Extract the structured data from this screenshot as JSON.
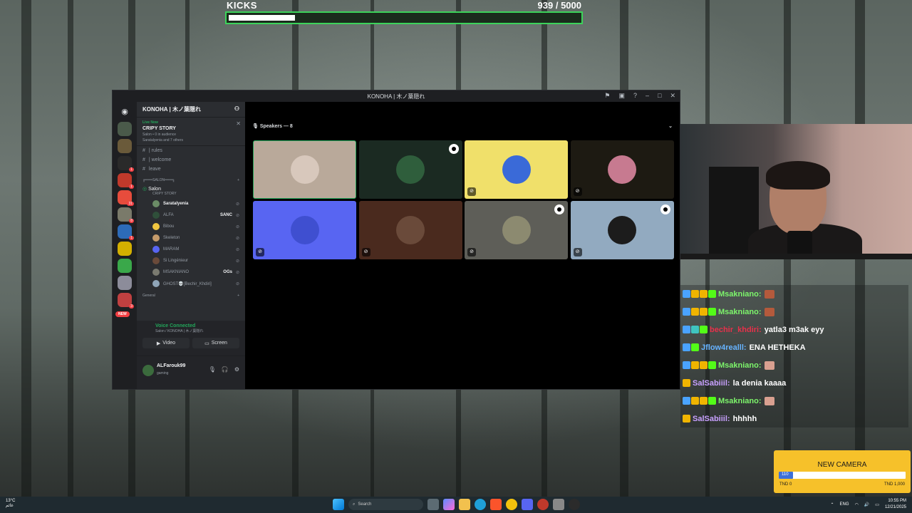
{
  "kicks": {
    "label": "KICKS",
    "count": "939",
    "goal": "/ 5000",
    "progress_fraction": 0.188
  },
  "discord": {
    "title": "KONOHA | 木ノ葉隠れ",
    "guild_name": "KONOHA | 木ノ葉隠れ",
    "event": {
      "live_label": "Live Now",
      "title": "CRIPY STORY",
      "meta": "Salon • 0 in audience",
      "participants": "Saratalyenia and 7 others"
    },
    "channels": {
      "rules_label": "| rules",
      "welcome_label": "| welcome",
      "leave_label": "leave",
      "category_salon": "╔═══SALON═══╗",
      "active_channel": "Salon",
      "active_channel_sub": "CRIPY STORY",
      "category_general": "General"
    },
    "voice_users": [
      {
        "name": "Saratalyenia",
        "tag": "",
        "color": "#6b8c66"
      },
      {
        "name": "ALFA",
        "tag": "SANC",
        "color": "#2f4f3a"
      },
      {
        "name": "Bibou",
        "tag": "",
        "color": "#f0c640"
      },
      {
        "name": "Skeleton",
        "tag": "",
        "color": "#c59b6b"
      },
      {
        "name": "MARAM",
        "tag": "",
        "color": "#5865f2"
      },
      {
        "name": "Si Lingénieur",
        "tag": "",
        "color": "#6a4a3a"
      },
      {
        "name": "MSAKNIANO",
        "tag": "OGs",
        "color": "#7a7a70"
      },
      {
        "name": "GHOST💀[Bechir_Khdiri]",
        "tag": "",
        "color": "#8fa5b8"
      }
    ],
    "voice_panel": {
      "status": "Voice Connected",
      "location": "Salon / KONOHA | 木ノ葉隠れ",
      "video_label": "Video",
      "screen_label": "Screen"
    },
    "user_panel": {
      "username": "ALFarouk99",
      "status": "gaming"
    },
    "stage": {
      "speakers_label": "Speakers — 8"
    },
    "tiles": [
      {
        "bg": "#b9a99a",
        "av": "#d8c8bc",
        "mute": false,
        "live": false
      },
      {
        "bg": "#1b2a22",
        "av": "#2f5e3c",
        "mute": false,
        "live": true
      },
      {
        "bg": "#f0e06a",
        "av": "#3a6ad8",
        "mute": true,
        "live": false
      },
      {
        "bg": "#1d1a12",
        "av": "#c77a90",
        "mute": true,
        "live": false
      },
      {
        "bg": "#5865f2",
        "av": "#3f4fd0",
        "mute": true,
        "live": false
      },
      {
        "bg": "#4a2a1e",
        "av": "#6a4a3a",
        "mute": true,
        "live": false
      },
      {
        "bg": "#5e5e58",
        "av": "#8c8a70",
        "mute": true,
        "live": true
      },
      {
        "bg": "#92aac0",
        "av": "#1c1c1c",
        "mute": true,
        "live": true
      }
    ]
  },
  "chat": [
    {
      "user": "Msakniano:",
      "user_color": "#7df56b",
      "text": "",
      "badges": [
        "#4aa3ff",
        "#f0b400",
        "#f0b400",
        "#53fc18"
      ],
      "emote": "#b45a3c"
    },
    {
      "user": "Msakniano:",
      "user_color": "#7df56b",
      "text": "",
      "badges": [
        "#4aa3ff",
        "#f0b400",
        "#f0b400",
        "#53fc18"
      ],
      "emote": "#b45a3c"
    },
    {
      "user": "bechir_khdiri:",
      "user_color": "#e8304a",
      "text": "yatla3 m3ak eyy",
      "badges": [
        "#4aa3ff",
        "#3fc5c0",
        "#53fc18"
      ],
      "emote": ""
    },
    {
      "user": "Jflow4realll:",
      "user_color": "#66b3ff",
      "text": "ENA HETHEKA",
      "badges": [
        "#4aa3ff",
        "#53fc18"
      ],
      "emote": ""
    },
    {
      "user": "Msakniano:",
      "user_color": "#7df56b",
      "text": "",
      "badges": [
        "#4aa3ff",
        "#f0b400",
        "#f0b400",
        "#53fc18"
      ],
      "emote": "#d9a090"
    },
    {
      "user": "SalSabiiil:",
      "user_color": "#c8a0ff",
      "text": "la denia kaaaa",
      "badges": [
        "#f0b400"
      ],
      "emote": ""
    },
    {
      "user": "Msakniano:",
      "user_color": "#7df56b",
      "text": "",
      "badges": [
        "#4aa3ff",
        "#f0b400",
        "#f0b400",
        "#53fc18"
      ],
      "emote": "#d9a090"
    },
    {
      "user": "SalSabiiil:",
      "user_color": "#c8a0ff",
      "text": "hhhhh",
      "badges": [
        "#f0b400"
      ],
      "emote": ""
    }
  ],
  "goal_widget": {
    "title": "NEW CAMERA",
    "current_label": "110",
    "min_label": "TND 0",
    "max_label": "TND 1,000",
    "progress_fraction": 0.11
  },
  "taskbar": {
    "weather_temp": "13°C",
    "weather_desc": "غائم",
    "search_placeholder": "Search",
    "language": "ENG",
    "time": "10:55 PM",
    "date": "12/21/2025"
  }
}
